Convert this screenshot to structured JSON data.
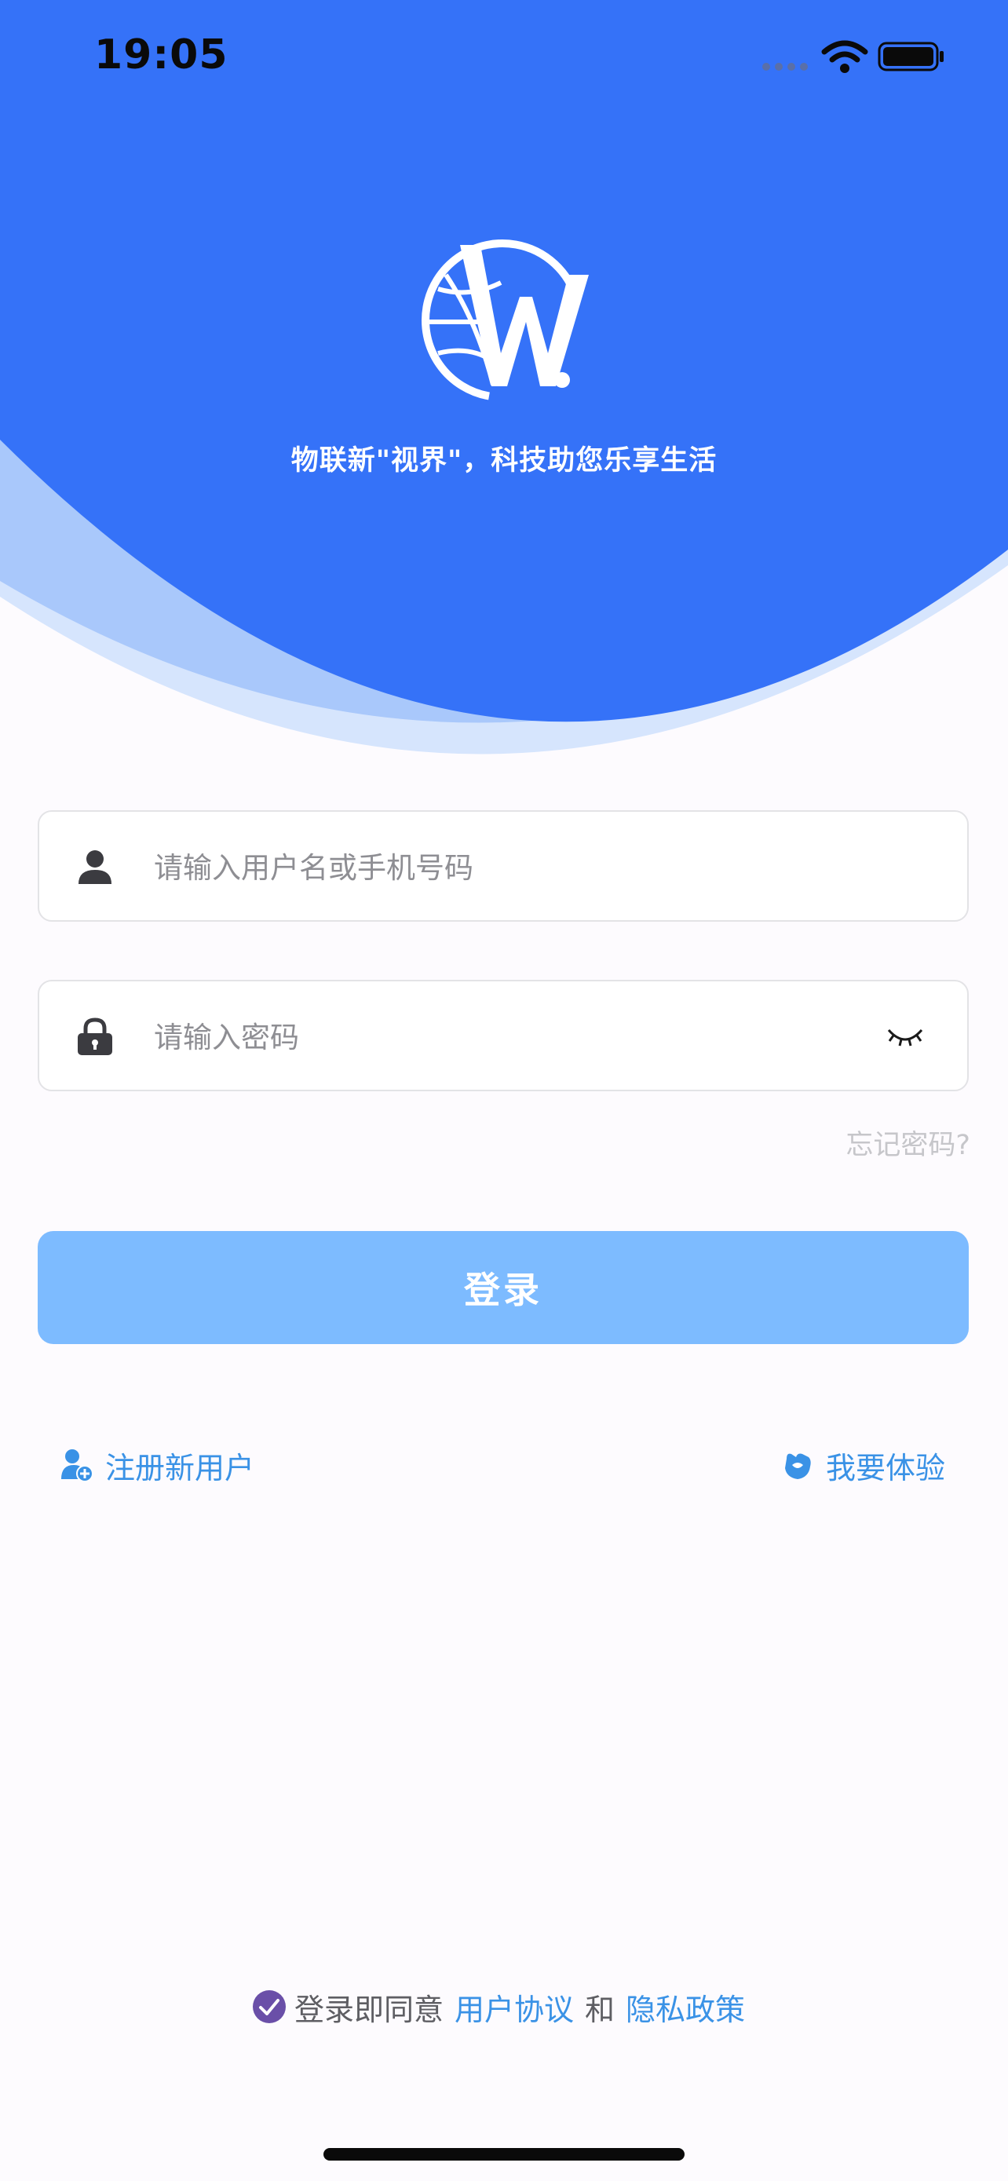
{
  "status_bar": {
    "time": "19:05"
  },
  "header": {
    "slogan": "物联新\"视界\"，科技助您乐享生活"
  },
  "form": {
    "username_placeholder": "请输入用户名或手机号码",
    "password_placeholder": "请输入密码",
    "forgot_password": "忘记密码?",
    "login_label": "登录"
  },
  "links": {
    "register": "注册新用户",
    "trial": "我要体验"
  },
  "agreement": {
    "prefix": "登录即同意",
    "user_agreement": "用户协议",
    "and": "和",
    "privacy_policy": "隐私政策"
  },
  "colors": {
    "header_blue": "#3572f8",
    "button_blue": "#7dbbff",
    "link_blue": "#3a92e6",
    "checkbox_purple": "#6a4fa8"
  }
}
